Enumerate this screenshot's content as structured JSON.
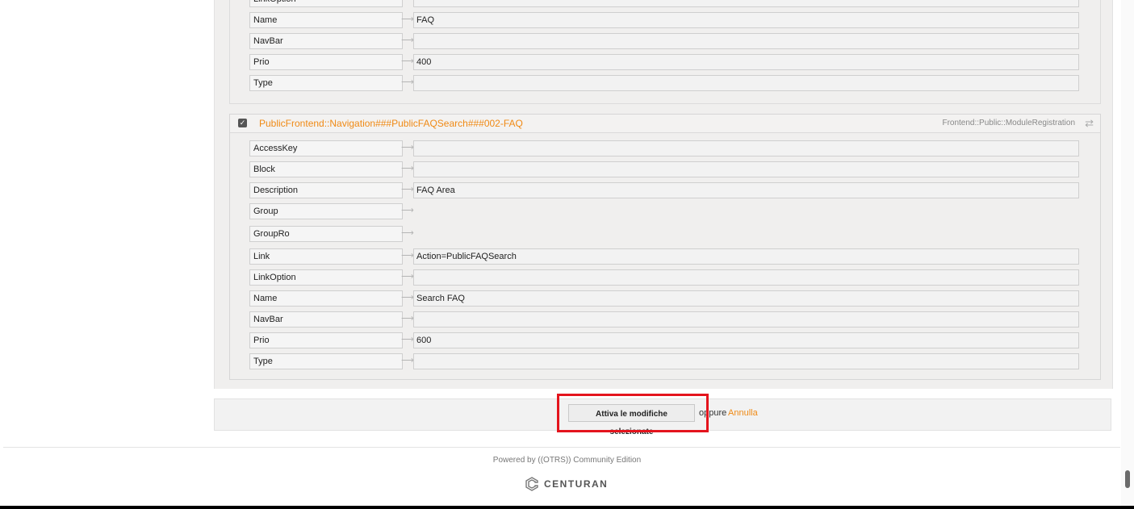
{
  "section1": {
    "rows": [
      {
        "key": "LinkOption",
        "value": ""
      },
      {
        "key": "Name",
        "value": "FAQ"
      },
      {
        "key": "NavBar",
        "value": ""
      },
      {
        "key": "Prio",
        "value": "400"
      },
      {
        "key": "Type",
        "value": ""
      }
    ]
  },
  "section2": {
    "title": "PublicFrontend::Navigation###PublicFAQSearch###002-FAQ",
    "module": "Frontend::Public::ModuleRegistration",
    "rows": [
      {
        "key": "AccessKey",
        "value": ""
      },
      {
        "key": "Block",
        "value": ""
      },
      {
        "key": "Description",
        "value": "FAQ Area"
      },
      {
        "key": "Group",
        "value": ""
      },
      {
        "key": "GroupRo",
        "value": ""
      },
      {
        "key": "Link",
        "value": "Action=PublicFAQSearch"
      },
      {
        "key": "LinkOption",
        "value": ""
      },
      {
        "key": "Name",
        "value": "Search FAQ"
      },
      {
        "key": "NavBar",
        "value": ""
      },
      {
        "key": "Prio",
        "value": "600"
      },
      {
        "key": "Type",
        "value": ""
      }
    ]
  },
  "actions": {
    "activate_label": "Attiva le modifiche selezionate",
    "oppure": "oppure",
    "annulla": "Annulla"
  },
  "footer": {
    "powered": "Powered by ((OTRS)) Community Edition",
    "logo": "CENTURAN"
  },
  "colors": {
    "accent": "#f08a15",
    "highlight": "#e4141d"
  }
}
